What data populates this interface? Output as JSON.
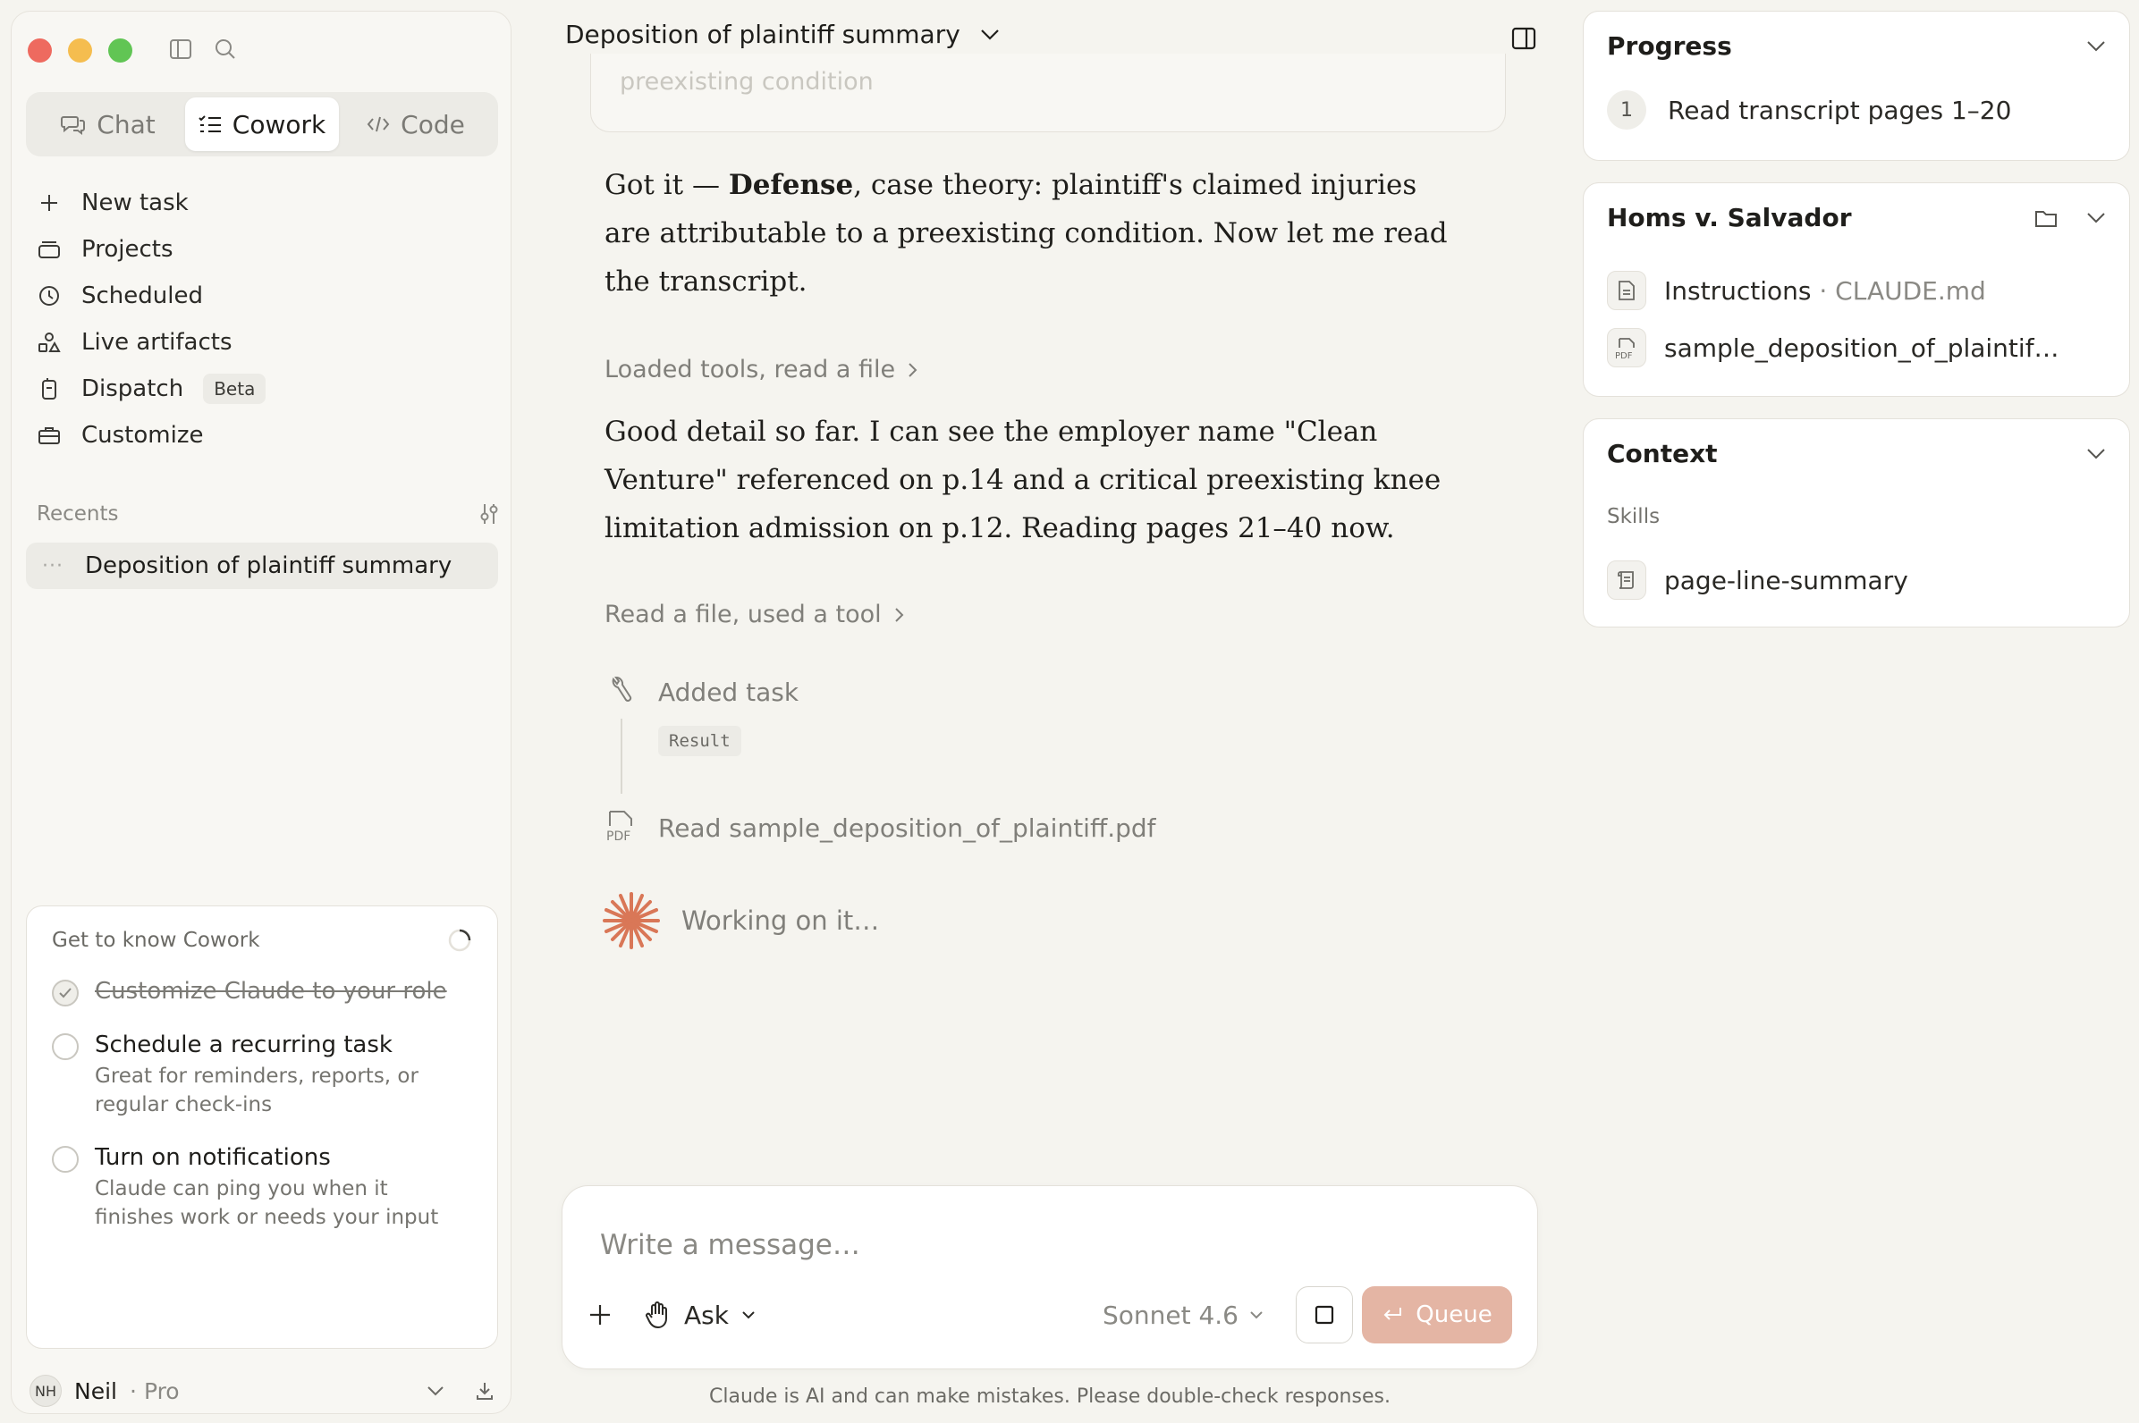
{
  "sidebar": {
    "modes": [
      {
        "label": "Chat",
        "icon": "chat-bubbles-icon"
      },
      {
        "label": "Cowork",
        "icon": "checklist-icon"
      },
      {
        "label": "Code",
        "icon": "code-icon"
      }
    ],
    "active_mode": "Cowork",
    "nav": [
      {
        "label": "New task",
        "icon": "plus-icon"
      },
      {
        "label": "Projects",
        "icon": "folder-stack-icon"
      },
      {
        "label": "Scheduled",
        "icon": "clock-icon"
      },
      {
        "label": "Live artifacts",
        "icon": "shapes-icon"
      },
      {
        "label": "Dispatch",
        "icon": "phone-icon",
        "badge": "Beta"
      },
      {
        "label": "Customize",
        "icon": "briefcase-icon"
      }
    ],
    "recents_label": "Recents",
    "recent_item": {
      "dots": "···",
      "label": "Deposition of plaintiff summary"
    },
    "onboarding": {
      "title": "Get to know Cowork",
      "items": [
        {
          "title": "Customize Claude to your role",
          "done": true
        },
        {
          "title": "Schedule a recurring task",
          "desc": "Great for reminders, reports, or regular check-ins",
          "done": false
        },
        {
          "title": "Turn on notifications",
          "desc": "Claude can ping you when it finishes work or needs your input",
          "done": false
        }
      ]
    },
    "user": {
      "initials": "NH",
      "name": "Neil",
      "separator": "·",
      "plan": "Pro"
    }
  },
  "conversation": {
    "title": "Deposition of plaintiff summary",
    "prev_card_text": "preexisting condition",
    "msg1": {
      "prefix": "Got it — ",
      "bold": "Defense",
      "rest": ", case theory: plaintiff's claimed injuries are attributable to a preexisting condition. Now let me read the transcript."
    },
    "step1": "Loaded tools, read a file",
    "msg2": "Good detail so far. I can see the employer name \"Clean Venture\" referenced on p.14 and a critical preexisting knee limitation admission on p.12. Reading pages 21–40 now.",
    "step2": "Read a file, used a tool",
    "timeline": {
      "added_task": "Added task",
      "result": "Result",
      "read_file": "Read sample_deposition_of_plaintiff.pdf",
      "pdf_tag": "PDF"
    },
    "working": "Working on it…"
  },
  "composer": {
    "placeholder": "Write a message…",
    "ask_label": "Ask",
    "model": "Sonnet 4.6",
    "queue_label": "Queue",
    "disclaimer": "Claude is AI and can make mistakes. Please double-check responses."
  },
  "right_panel": {
    "progress": {
      "title": "Progress",
      "step_number": "1",
      "step_label": "Read transcript pages 1–20"
    },
    "project": {
      "title": "Homs v. Salvador",
      "files": [
        {
          "name": "Instructions",
          "separator": "·",
          "detail": "CLAUDE.md"
        },
        {
          "name": "sample_deposition_of_plaintif…",
          "tag": "PDF"
        }
      ]
    },
    "context": {
      "title": "Context",
      "skills_label": "Skills",
      "skill": "page-line-summary"
    }
  },
  "colors": {
    "accent": "#d97757",
    "queue_button": "#e4b5a4",
    "background": "#f5f4ef",
    "traffic_red": "#ee6a5f",
    "traffic_yellow": "#f5bd4f",
    "traffic_green": "#61c554"
  }
}
